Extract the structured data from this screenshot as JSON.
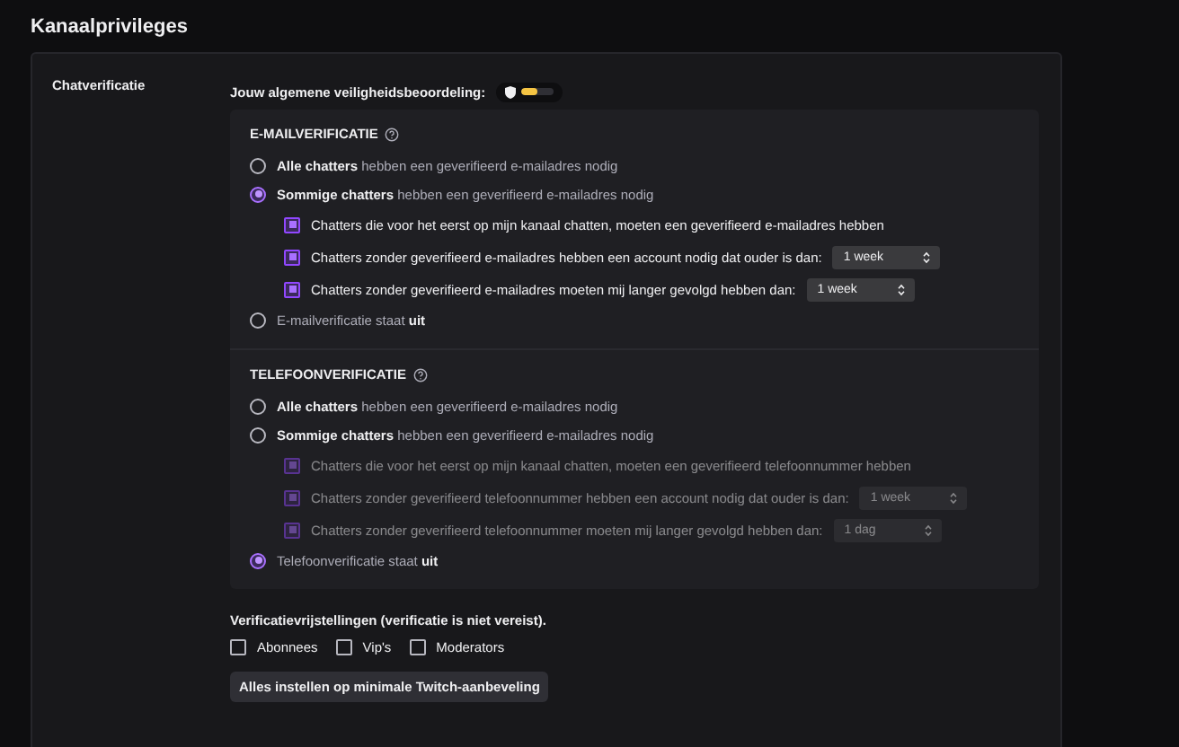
{
  "page_title": "Kanaalprivileges",
  "section": {
    "label": "Chatverificatie",
    "safety_rating": {
      "label": "Jouw algemene veiligheidsbeoordeling:",
      "level": 0.5
    },
    "groups": [
      {
        "heading": "E-MAILVERIFICATIE",
        "options": [
          {
            "text": "**Alle chatters** hebben een geverifieerd e-mailadres nodig",
            "selected": false
          },
          {
            "text": "**Sommige chatters** hebben een geverifieerd e-mailadres nodig",
            "selected": true,
            "sub_options": [
              {
                "text": "Chatters die voor het eerst op mijn kanaal chatten, moeten een geverifieerd e-mailadres hebben",
                "checked": true,
                "disabled": false
              },
              {
                "text": "Chatters zonder geverifieerd e-mailadres hebben een account nodig dat ouder is dan:",
                "checked": true,
                "disabled": false,
                "dropdown": "1 week"
              },
              {
                "text": "Chatters zonder geverifieerd e-mailadres moeten mij langer gevolgd hebben dan:",
                "checked": true,
                "disabled": false,
                "dropdown": "1 week"
              }
            ]
          },
          {
            "text": "E-mailverificatie staat **uit**",
            "selected": false
          }
        ]
      },
      {
        "heading": "TELEFOONVERIFICATIE",
        "options": [
          {
            "text": "**Alle chatters** hebben een geverifieerd e-mailadres nodig",
            "selected": false
          },
          {
            "text": "**Sommige chatters** hebben een geverifieerd e-mailadres nodig",
            "selected": false,
            "sub_options": [
              {
                "text": "Chatters die voor het eerst op mijn kanaal chatten, moeten een geverifieerd telefoonnummer hebben",
                "checked": true,
                "disabled": true
              },
              {
                "text": "Chatters zonder geverifieerd telefoonnummer hebben een account nodig dat ouder is dan:",
                "checked": true,
                "disabled": true,
                "dropdown": "1 week"
              },
              {
                "text": "Chatters zonder geverifieerd telefoonnummer moeten mij langer gevolgd hebben dan:",
                "checked": true,
                "disabled": true,
                "dropdown": "1 dag"
              }
            ]
          },
          {
            "text": "Telefoonverificatie staat **uit**",
            "selected": true
          }
        ]
      }
    ],
    "exemptions": {
      "label": "Verificatievrijstellingen (verificatie is niet vereist).",
      "options": [
        {
          "label": "Abonnees",
          "checked": false
        },
        {
          "label": "Vip's",
          "checked": false
        },
        {
          "label": "Moderators",
          "checked": false
        }
      ]
    },
    "button": "Alles instellen op minimale Twitch-aanbeveling"
  }
}
